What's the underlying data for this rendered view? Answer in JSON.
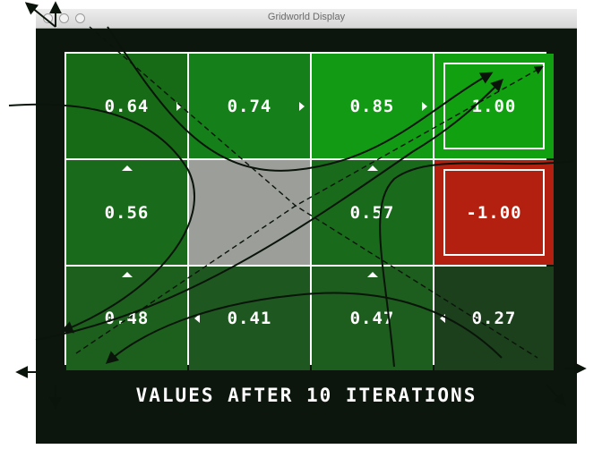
{
  "window": {
    "title": "Gridworld Display"
  },
  "grid": {
    "rows": [
      [
        {
          "value": "0.64",
          "kind": "state",
          "policy": "right",
          "color": "#176b17"
        },
        {
          "value": "0.74",
          "kind": "state",
          "policy": "right",
          "color": "#15801a"
        },
        {
          "value": "0.85",
          "kind": "state",
          "policy": "right",
          "color": "#129a14"
        },
        {
          "value": "1.00",
          "kind": "terminal",
          "policy": "",
          "color": "#10a010"
        }
      ],
      [
        {
          "value": "0.56",
          "kind": "state",
          "policy": "up",
          "color": "#1a6a1c"
        },
        {
          "value": "",
          "kind": "wall",
          "policy": "",
          "color": "#9c9f99"
        },
        {
          "value": "0.57",
          "kind": "state",
          "policy": "up",
          "color": "#1a6a1c"
        },
        {
          "value": "-1.00",
          "kind": "terminal",
          "policy": "",
          "color": "#b3200f"
        }
      ],
      [
        {
          "value": "0.48",
          "kind": "state",
          "policy": "up",
          "color": "#1d5f1d"
        },
        {
          "value": "0.41",
          "kind": "state",
          "policy": "left",
          "color": "#1f5720"
        },
        {
          "value": "0.47",
          "kind": "state",
          "policy": "up",
          "color": "#1d5d1d"
        },
        {
          "value": "0.27",
          "kind": "state",
          "policy": "left",
          "color": "#1c3f1c"
        }
      ]
    ]
  },
  "caption": "VALUES AFTER 10 ITERATIONS"
}
